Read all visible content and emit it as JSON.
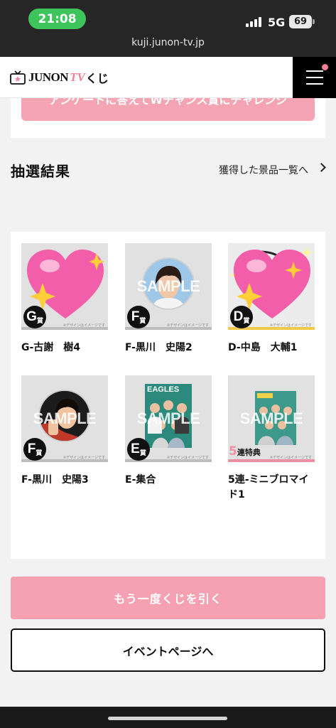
{
  "status_bar": {
    "time": "21:08",
    "network": "5G",
    "battery": "69",
    "url": "kuji.junon-tv.jp"
  },
  "header": {
    "logo_junon": "JUNON",
    "logo_tv": "TV",
    "logo_kuji": "くじ",
    "menu_icon": "hamburger-icon",
    "notification_color": "#f07e97"
  },
  "survey_button": "アンケートに答えてWチャンス賞にチャレンジ",
  "results_section": {
    "title": "抽選結果",
    "prize_list_link": "獲得した景品一覧へ"
  },
  "watermark": "SAMPLE",
  "image_note": "※デザインはイメージです",
  "items": [
    {
      "badge": "G",
      "badge_suffix": "賞",
      "label": "G-古謝　樹4",
      "image": "heart-sparkle"
    },
    {
      "badge": "F",
      "badge_suffix": "賞",
      "label": "F-黒川　史陽2",
      "image": "can-badge"
    },
    {
      "badge": "D",
      "badge_suffix": "賞",
      "label": "D-中島　大輔1",
      "image": "heart-sparkle",
      "accent": "#f3c94a"
    },
    {
      "badge": "F",
      "badge_suffix": "賞",
      "label": "F-黒川　史陽3",
      "image": "can-badge"
    },
    {
      "badge": "E",
      "badge_suffix": "賞",
      "label": "E-集合",
      "image": "group-photo",
      "photo_title": "EAGLES"
    },
    {
      "badge": "",
      "badge_suffix": "",
      "label": "5連-ミニブロマイド1",
      "image": "mini-bromide",
      "bonus_num": "5",
      "bonus_text": "連特典",
      "accent": "#f08ea3"
    }
  ],
  "buttons": {
    "redraw": "もう一度くじを引く",
    "event_page": "イベントページへ"
  },
  "colors": {
    "pink": "#f5a1b1",
    "brand_pink": "#f07e97",
    "time_green": "#3dc45a"
  }
}
